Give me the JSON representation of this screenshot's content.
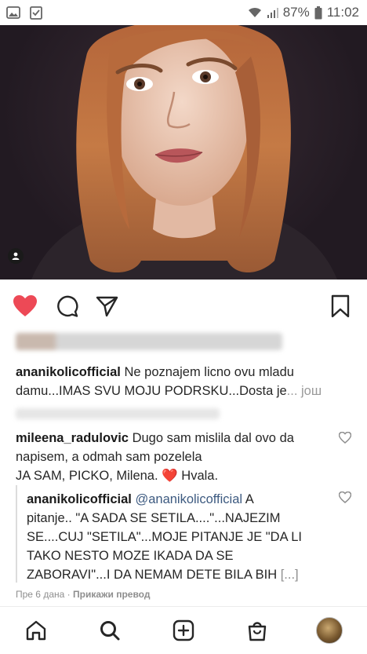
{
  "status_bar": {
    "battery": "87%",
    "time": "11:02"
  },
  "post": {
    "caption": {
      "username": "ananikolicofficial",
      "text": "Ne poznajem licno ovu mladu damu...IMAS SVU MOJU PODRSKU...Dosta je",
      "more": "... још"
    }
  },
  "comments": [
    {
      "username": "mileena_radulovic",
      "text_line1": "Dugo sam mislila dal ovo da",
      "text_line2": "napisem, a odmah sam pozelela",
      "text_line3": "JA SAM, PICKO, Milena.",
      "emoji": "❤️",
      "text_after": "Hvala."
    },
    {
      "username": "ananikolicofficial",
      "mention": "@ananikolicofficial",
      "text_first": "A",
      "line2": "pitanje.. \"A SADA SE SETILA....\"...NAJEZIM",
      "line3": "SE....CUJ \"SETILA\"...MOJE PITANJE JE \"DA LI",
      "line4": "TAKO NESTO MOZE IKADA DA SE",
      "line5": "ZABORAVI\"...I DA NEMAM DETE BILA BIH",
      "ellipsis": "[...]"
    }
  ],
  "meta": {
    "time_ago": "Пре 6 дана",
    "separator": "·",
    "translate": "Прикажи превод"
  },
  "colors": {
    "like_red": "#ed4956",
    "mention_blue": "#3d5a80",
    "muted_gray": "#8e8e8e"
  },
  "icons": {
    "like": "heart-icon",
    "comment": "comment-icon",
    "share": "share-icon",
    "save": "bookmark-icon",
    "home": "home-icon",
    "search": "search-icon",
    "create": "plus-square-icon",
    "shop": "shopping-bag-icon"
  }
}
